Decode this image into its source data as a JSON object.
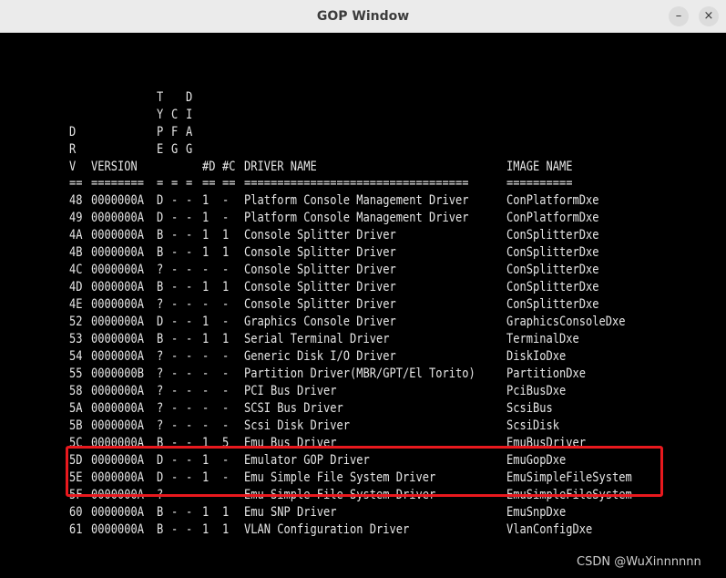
{
  "window": {
    "title": "GOP Window",
    "minimize_glyph": "–",
    "close_glyph": "×"
  },
  "header": {
    "labels": [
      {
        "col": "drv",
        "lines": [
          "",
          "",
          "D",
          "R",
          "V"
        ]
      },
      {
        "col": "version",
        "lines": [
          "",
          "",
          "",
          "",
          "VERSION"
        ]
      },
      {
        "col": "type",
        "lines": [
          "T",
          "Y",
          "P",
          "E",
          ""
        ]
      },
      {
        "col": "cfg",
        "lines": [
          "",
          "C",
          "F",
          "G",
          ""
        ]
      },
      {
        "col": "diag",
        "lines": [
          "D",
          "I",
          "A",
          "G",
          ""
        ]
      },
      {
        "col": "nd",
        "lines": [
          "",
          "",
          "",
          "",
          "#D"
        ]
      },
      {
        "col": "nc",
        "lines": [
          "",
          "",
          "",
          "",
          "#C"
        ]
      },
      {
        "col": "name",
        "lines": [
          "",
          "",
          "",
          "",
          "DRIVER NAME"
        ]
      },
      {
        "col": "image",
        "lines": [
          "",
          "",
          "",
          "",
          "IMAGE NAME"
        ]
      }
    ],
    "separator": [
      "==",
      "========",
      "=",
      "=",
      "=",
      "==",
      "==",
      "==================================",
      "=========="
    ]
  },
  "rows": [
    {
      "drv": "48",
      "version": "0000000A",
      "type": "D",
      "cfg": "-",
      "diag": "-",
      "nd": "1",
      "nc": "-",
      "name": "Platform Console Management Driver",
      "image": "ConPlatformDxe"
    },
    {
      "drv": "49",
      "version": "0000000A",
      "type": "D",
      "cfg": "-",
      "diag": "-",
      "nd": "1",
      "nc": "-",
      "name": "Platform Console Management Driver",
      "image": "ConPlatformDxe"
    },
    {
      "drv": "4A",
      "version": "0000000A",
      "type": "B",
      "cfg": "-",
      "diag": "-",
      "nd": "1",
      "nc": "1",
      "name": "Console Splitter Driver",
      "image": "ConSplitterDxe"
    },
    {
      "drv": "4B",
      "version": "0000000A",
      "type": "B",
      "cfg": "-",
      "diag": "-",
      "nd": "1",
      "nc": "1",
      "name": "Console Splitter Driver",
      "image": "ConSplitterDxe"
    },
    {
      "drv": "4C",
      "version": "0000000A",
      "type": "?",
      "cfg": "-",
      "diag": "-",
      "nd": "-",
      "nc": "-",
      "name": "Console Splitter Driver",
      "image": "ConSplitterDxe"
    },
    {
      "drv": "4D",
      "version": "0000000A",
      "type": "B",
      "cfg": "-",
      "diag": "-",
      "nd": "1",
      "nc": "1",
      "name": "Console Splitter Driver",
      "image": "ConSplitterDxe"
    },
    {
      "drv": "4E",
      "version": "0000000A",
      "type": "?",
      "cfg": "-",
      "diag": "-",
      "nd": "-",
      "nc": "-",
      "name": "Console Splitter Driver",
      "image": "ConSplitterDxe"
    },
    {
      "drv": "52",
      "version": "0000000A",
      "type": "D",
      "cfg": "-",
      "diag": "-",
      "nd": "1",
      "nc": "-",
      "name": "Graphics Console Driver",
      "image": "GraphicsConsoleDxe"
    },
    {
      "drv": "53",
      "version": "0000000A",
      "type": "B",
      "cfg": "-",
      "diag": "-",
      "nd": "1",
      "nc": "1",
      "name": "Serial Terminal Driver",
      "image": "TerminalDxe"
    },
    {
      "drv": "54",
      "version": "0000000A",
      "type": "?",
      "cfg": "-",
      "diag": "-",
      "nd": "-",
      "nc": "-",
      "name": "Generic Disk I/O Driver",
      "image": "DiskIoDxe"
    },
    {
      "drv": "55",
      "version": "0000000B",
      "type": "?",
      "cfg": "-",
      "diag": "-",
      "nd": "-",
      "nc": "-",
      "name": "Partition Driver(MBR/GPT/El Torito)",
      "image": "PartitionDxe"
    },
    {
      "drv": "58",
      "version": "0000000A",
      "type": "?",
      "cfg": "-",
      "diag": "-",
      "nd": "-",
      "nc": "-",
      "name": "PCI Bus Driver",
      "image": "PciBusDxe"
    },
    {
      "drv": "5A",
      "version": "0000000A",
      "type": "?",
      "cfg": "-",
      "diag": "-",
      "nd": "-",
      "nc": "-",
      "name": "SCSI Bus Driver",
      "image": "ScsiBus"
    },
    {
      "drv": "5B",
      "version": "0000000A",
      "type": "?",
      "cfg": "-",
      "diag": "-",
      "nd": "-",
      "nc": "-",
      "name": "Scsi Disk Driver",
      "image": "ScsiDisk"
    },
    {
      "drv": "5C",
      "version": "0000000A",
      "type": "B",
      "cfg": "-",
      "diag": "-",
      "nd": "1",
      "nc": "5",
      "name": "Emu Bus Driver",
      "image": "EmuBusDriver"
    },
    {
      "drv": "5D",
      "version": "0000000A",
      "type": "D",
      "cfg": "-",
      "diag": "-",
      "nd": "1",
      "nc": "-",
      "name": "Emulator GOP Driver",
      "image": "EmuGopDxe"
    },
    {
      "drv": "5E",
      "version": "0000000A",
      "type": "D",
      "cfg": "-",
      "diag": "-",
      "nd": "1",
      "nc": "-",
      "name": "Emu Simple File System Driver",
      "image": "EmuSimpleFileSystem"
    },
    {
      "drv": "5F",
      "version": "0000000A",
      "type": "?",
      "cfg": "-",
      "diag": "-",
      "nd": "-",
      "nc": "-",
      "name": "Emu Simple File System Driver",
      "image": "EmuSimpleFileSystem"
    },
    {
      "drv": "60",
      "version": "0000000A",
      "type": "B",
      "cfg": "-",
      "diag": "-",
      "nd": "1",
      "nc": "1",
      "name": "Emu SNP Driver",
      "image": "EmuSnpDxe"
    },
    {
      "drv": "61",
      "version": "0000000A",
      "type": "B",
      "cfg": "-",
      "diag": "-",
      "nd": "1",
      "nc": "1",
      "name": "VLAN Configuration Driver",
      "image": "VlanConfigDxe"
    }
  ],
  "highlight": {
    "color": "#e8191e",
    "rows": [
      "5E",
      "5F"
    ]
  },
  "watermark": "CSDN @WuXinnnnnn",
  "colors": {
    "console_bg": "#000000",
    "console_text": "#e6e6e6",
    "titlebar_bg": "#ebebeb"
  }
}
